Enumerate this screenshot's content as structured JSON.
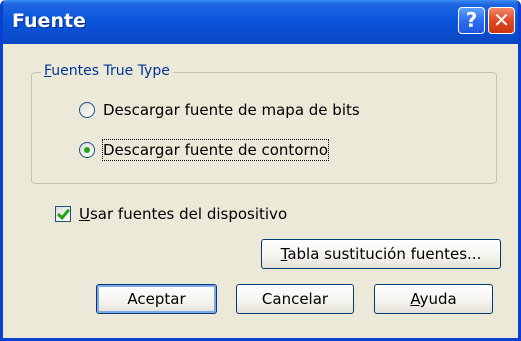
{
  "window": {
    "title": "Fuente",
    "help_glyph": "?",
    "close_glyph": "✕"
  },
  "group": {
    "legend_access": "F",
    "legend_rest": "uentes True Type"
  },
  "radios": [
    {
      "label": "Descargar fuente de mapa de bits",
      "checked": false
    },
    {
      "label": "Descargar fuente de contorno",
      "checked": true
    }
  ],
  "device_fonts": {
    "access": "U",
    "rest": "sar fuentes del dispositivo",
    "checked": true
  },
  "buttons": {
    "substitution_access": "T",
    "substitution_rest": "abla sustitución fuentes...",
    "ok": "Aceptar",
    "cancel": "Cancelar",
    "help_access": "A",
    "help_rest": "yuda"
  },
  "colors": {
    "titlebar": "#0a55dc",
    "dialog_bg": "#ece9d8",
    "group_label": "#003399",
    "check_green": "#21a121"
  }
}
